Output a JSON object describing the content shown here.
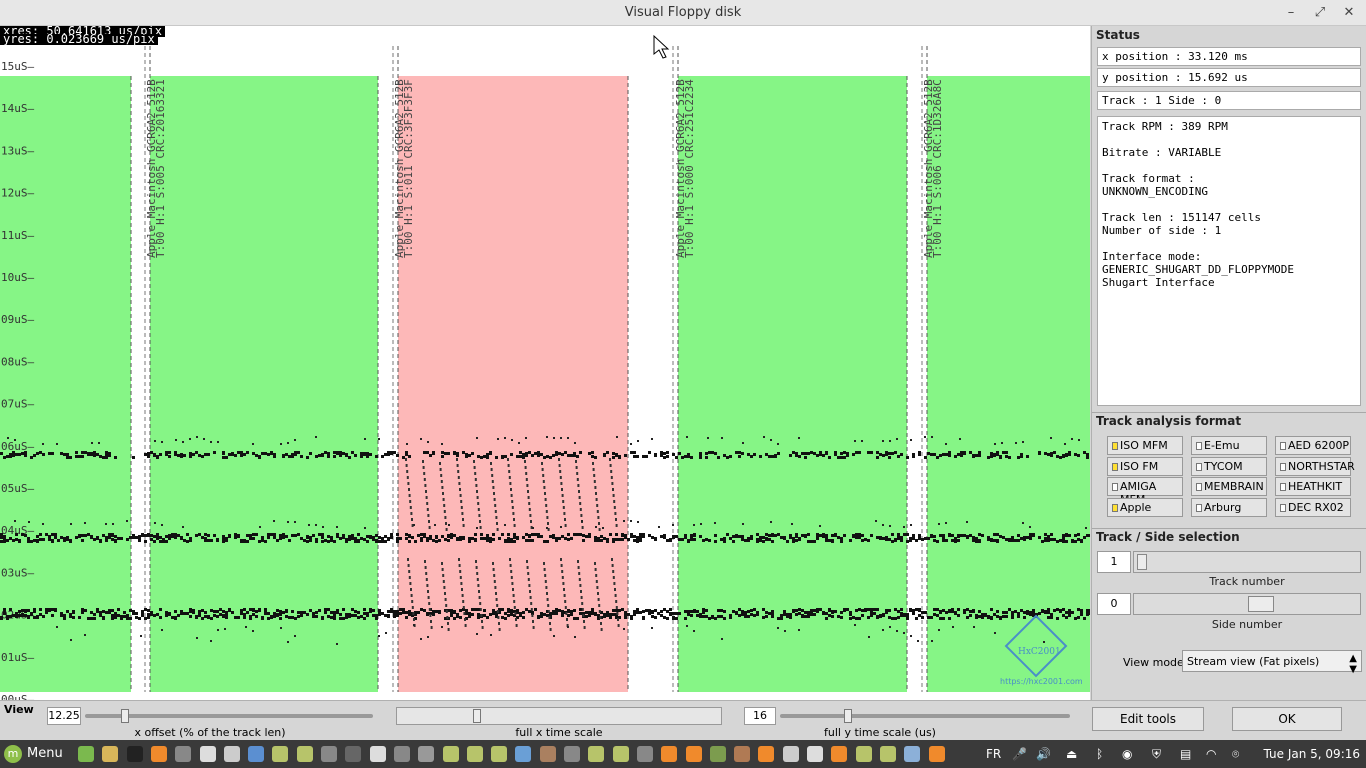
{
  "window": {
    "title": "Visual Floppy disk",
    "btn_minimize": "–",
    "btn_restore": "⤢",
    "btn_close": "✕"
  },
  "viewport": {
    "xres": "xres: 50.641613 us/pix",
    "yres": "yres: 0.023669 us/pix",
    "y_ticks": [
      "15uS–",
      "14uS–",
      "13uS–",
      "12uS–",
      "11uS–",
      "10uS–",
      "09uS–",
      "08uS–",
      "07uS–",
      "06uS–",
      "05uS–",
      "04uS–",
      "03uS–",
      "02uS–",
      "01uS–",
      "00uS–"
    ],
    "sectors": [
      {
        "line1": "Apple Macintosh GCR6A2 512B",
        "line2": "T:00 H:1 S:005 CRC:20163321",
        "status": "ok"
      },
      {
        "line1": "Apple Macintosh GCR6A2 512B",
        "line2": "T:00 H:1 S:011 CRC:3F3F3F3F",
        "status": "bad"
      },
      {
        "line1": "Apple Macintosh GCR6A2 512B",
        "line2": "T:00 H:1 S:000 CRC:251C2234",
        "status": "ok"
      },
      {
        "line1": "Apple Macintosh GCR6A2 512B",
        "line2": "T:00 H:1 S:006 CRC:1D326A8C",
        "status": "ok"
      }
    ],
    "watermark": "https://hxc2001.com",
    "watermark_logo": "HxC2001",
    "colors": {
      "ok": "#86f586",
      "bad": "#fdb8b8"
    }
  },
  "status": {
    "title": "Status",
    "x_position": "x position : 33.120 ms",
    "y_position": "y position : 15.692 us",
    "track_side": "Track : 1 Side : 0",
    "info": [
      "Track RPM : 389 RPM",
      "",
      "Bitrate : VARIABLE",
      "",
      "Track format :",
      "UNKNOWN_ENCODING",
      "",
      "Track len : 151147 cells",
      "Number of side : 1",
      "",
      "Interface mode:",
      "GENERIC_SHUGART_DD_FLOPPYMODE",
      "Shugart Interface"
    ]
  },
  "formats": {
    "title": "Track analysis format",
    "items": [
      {
        "label": "ISO MFM",
        "checked": true
      },
      {
        "label": "E-Emu",
        "checked": false
      },
      {
        "label": "AED 6200P",
        "checked": false
      },
      {
        "label": "ISO FM",
        "checked": true
      },
      {
        "label": "TYCOM",
        "checked": false
      },
      {
        "label": "NORTHSTAR",
        "checked": false
      },
      {
        "label": "AMIGA MFM",
        "checked": false
      },
      {
        "label": "MEMBRAIN",
        "checked": false
      },
      {
        "label": "HEATHKIT",
        "checked": false
      },
      {
        "label": "Apple",
        "checked": true
      },
      {
        "label": "Arburg",
        "checked": false
      },
      {
        "label": "DEC RX02",
        "checked": false
      }
    ]
  },
  "selection": {
    "title": "Track / Side selection",
    "track_value": "1",
    "track_label": "Track number",
    "side_value": "0",
    "side_label": "Side number",
    "view_mode_label": "View mode",
    "view_mode_value": "Stream view (Fat pixels)"
  },
  "bottom": {
    "view_label": "View",
    "x_offset_value": "12.25",
    "x_offset_label": "x offset (% of the track len)",
    "x_scale_label": "full x time scale",
    "y_scale_value": "16",
    "y_scale_label": "full y time scale (us)",
    "edit_tools": "Edit tools",
    "ok": "OK"
  },
  "taskbar": {
    "menu": "Menu",
    "lang": "FR",
    "clock": "Tue Jan  5, 09:16"
  }
}
